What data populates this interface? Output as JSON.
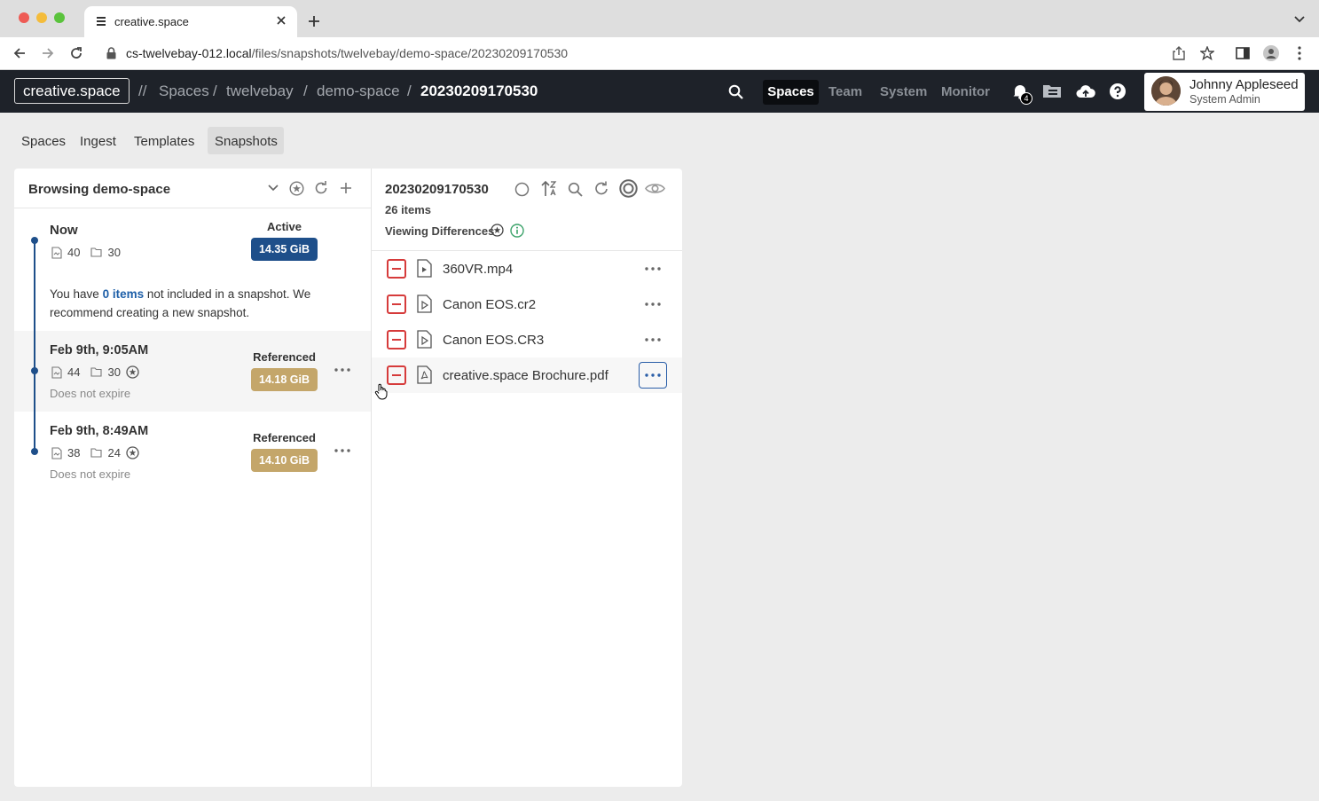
{
  "browser": {
    "tab_title": "creative.space",
    "url_host": "cs-twelvebay-012.local",
    "url_path": "/files/snapshots/twelvebay/demo-space/20230209170530"
  },
  "header": {
    "logo": "creative.space",
    "breadcrumb_prefix": "//",
    "breadcrumbs": [
      "Spaces",
      "twelvebay",
      "demo-space",
      "20230209170530"
    ],
    "separator": "/",
    "nav": [
      "Spaces",
      "Team",
      "System",
      "Monitor"
    ],
    "notification_count": "4",
    "user": {
      "name": "Johnny Appleseed",
      "role": "System Admin"
    }
  },
  "subnav": {
    "tabs": [
      "Spaces",
      "Ingest",
      "Templates",
      "Snapshots"
    ],
    "active": "Snapshots"
  },
  "left_panel": {
    "title": "Browsing demo-space",
    "current": {
      "title": "Now",
      "files": "40",
      "folders": "30",
      "status": "Active",
      "size": "14.35 GiB",
      "note_before": "You have",
      "note_link": "0 items",
      "note_after_line1": "not included in a snapshot. We",
      "note_line2": "recommend creating a new snapshot."
    },
    "snapshots": [
      {
        "title": "Feb 9th, 9:05AM",
        "files": "44",
        "folders": "30",
        "status": "Referenced",
        "size": "14.18 GiB",
        "expire": "Does not expire"
      },
      {
        "title": "Feb 9th, 8:49AM",
        "files": "38",
        "folders": "24",
        "status": "Referenced",
        "size": "14.10 GiB",
        "expire": "Does not expire"
      }
    ]
  },
  "right_panel": {
    "title": "20230209170530",
    "count": "26 items",
    "viewing": "Viewing Differences",
    "files": [
      {
        "name": "360VR.mp4",
        "icon": "video-file-icon"
      },
      {
        "name": "Canon EOS.cr2",
        "icon": "media-file-icon"
      },
      {
        "name": "Canon EOS.CR3",
        "icon": "media-file-icon"
      },
      {
        "name": "creative.space Brochure.pdf",
        "icon": "pdf-file-icon"
      }
    ]
  },
  "colors": {
    "active_badge": "#1e4f8a",
    "referenced_badge": "#c4a66a",
    "diff_removed": "#d63b3b",
    "header_bg": "#1e2229",
    "link": "#1e5fa8"
  }
}
